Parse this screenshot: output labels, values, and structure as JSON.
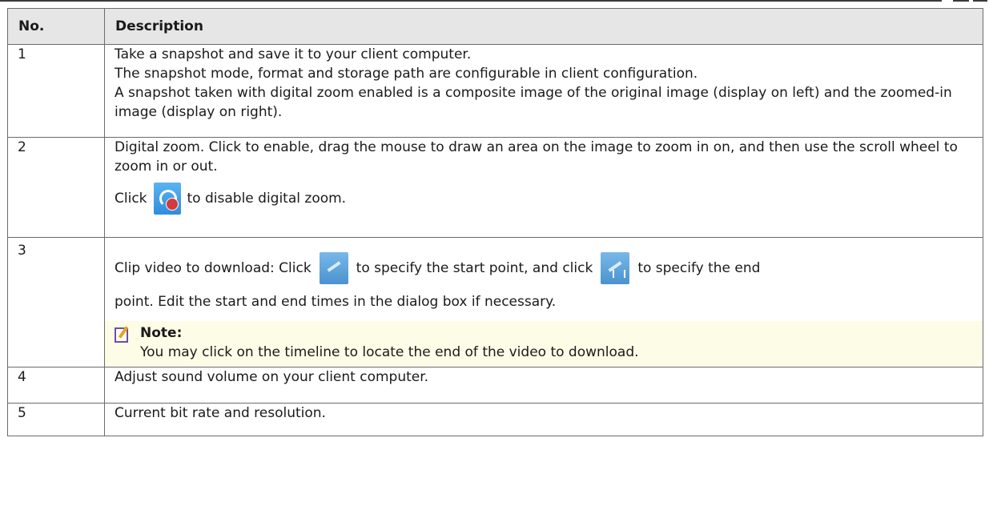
{
  "table": {
    "headers": [
      "No.",
      "Description"
    ],
    "rows": [
      {
        "no": "1",
        "lines": [
          "Take a snapshot and save it to your client computer.",
          "The snapshot mode, format and storage path are configurable in client configuration.",
          "A snapshot taken with digital zoom enabled is a composite image of the original image (display on left) and the zoomed-in image (display on right)."
        ]
      },
      {
        "no": "2",
        "para1": "Digital zoom. Click to enable, drag the mouse to draw an area on the image to zoom in on, and then use the scroll wheel to zoom in or out.",
        "click_label": "Click",
        "click_suffix": "to disable digital zoom.",
        "icon": "digital-zoom-off-icon"
      },
      {
        "no": "3",
        "part1": "Clip video to download: Click",
        "part2": "to specify the start point, and click",
        "part3": "to specify the end",
        "line2": "point. Edit the start and end times in the dialog box if necessary.",
        "icon_start": "clip-start-icon",
        "icon_end": "clip-end-icon",
        "note_title": "Note:",
        "note_text": "You may click on the timeline to locate the end of the video to download."
      },
      {
        "no": "4",
        "text": "Adjust sound volume on your client computer."
      },
      {
        "no": "5",
        "text": "Current bit rate and resolution."
      }
    ]
  },
  "colors": {
    "header_bg": "#e6e6e6",
    "border": "#6b6b6b",
    "note_bg": "#fdfce6",
    "icon_blue": "#2f8ddc"
  }
}
